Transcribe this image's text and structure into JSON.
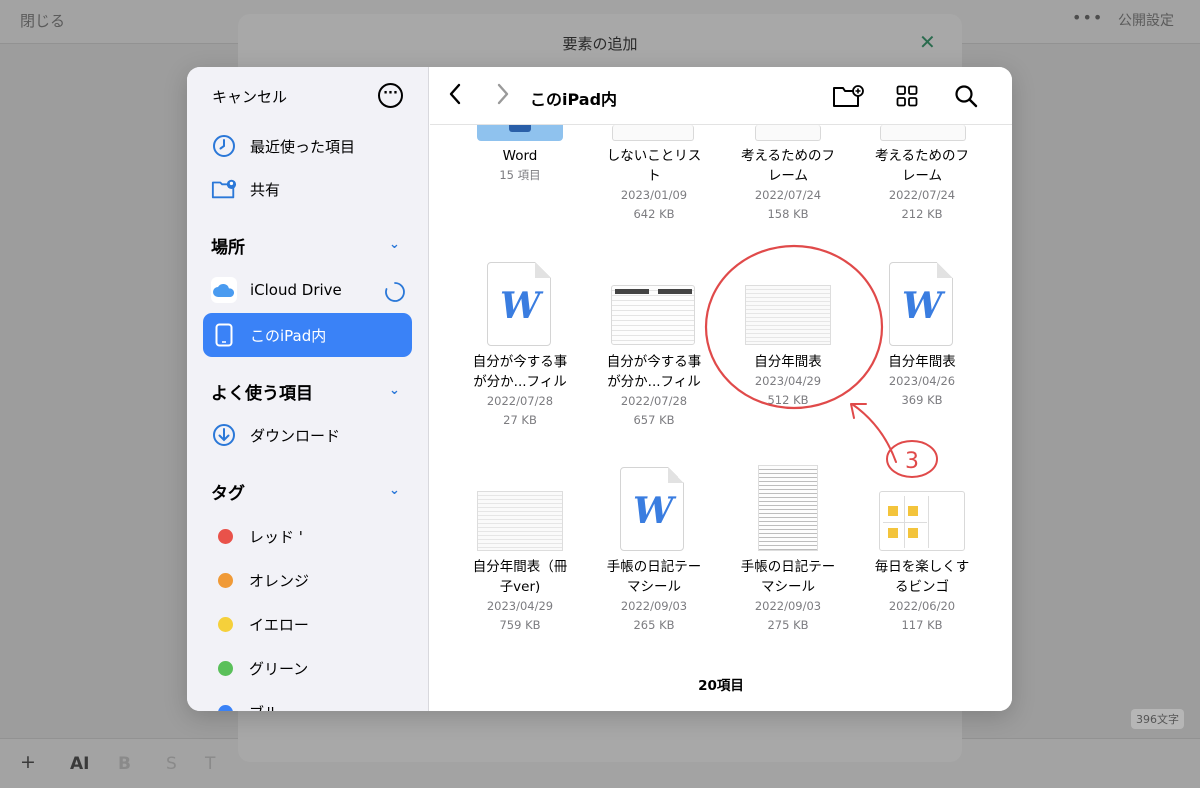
{
  "background": {
    "close_label": "閉じる",
    "more_label": "•••",
    "public_label": "公開設定",
    "word_count": "396文字",
    "toolbar": {
      "plus": "+",
      "ai": "AI",
      "bold": "B",
      "strike": "S",
      "text": "T"
    }
  },
  "sheet": {
    "title": "要素の追加"
  },
  "sidebar": {
    "cancel_label": "キャンセル",
    "recent_label": "最近使った項目",
    "shared_label": "共有",
    "locations_header": "場所",
    "icloud_label": "iCloud Drive",
    "ipad_label": "このiPad内",
    "favorites_header": "よく使う項目",
    "downloads_label": "ダウンロード",
    "tags_header": "タグ",
    "tags": [
      {
        "label": "レッド '",
        "color": "#e9524a"
      },
      {
        "label": "オレンジ",
        "color": "#f09a37"
      },
      {
        "label": "イエロー",
        "color": "#f5d03b"
      },
      {
        "label": "グリーン",
        "color": "#5ac05a"
      },
      {
        "label": "ブル",
        "color": "#3a82f7"
      }
    ]
  },
  "main": {
    "location_title": "このiPad内",
    "item_count": "20項目",
    "files": [
      {
        "name1": "Word",
        "name2": "",
        "date": "15 項目",
        "size": ""
      },
      {
        "name1": "しないことリス",
        "name2": "ト",
        "date": "2023/01/09",
        "size": "642 KB"
      },
      {
        "name1": "考えるためのフ",
        "name2": "レーム",
        "date": "2022/07/24",
        "size": "158 KB"
      },
      {
        "name1": "考えるためのフ",
        "name2": "レーム",
        "date": "2022/07/24",
        "size": "212 KB"
      },
      {
        "name1": "自分が今する事",
        "name2": "が分か...フィル",
        "date": "2022/07/28",
        "size": "27 KB"
      },
      {
        "name1": "自分が今する事",
        "name2": "が分か...フィル",
        "date": "2022/07/28",
        "size": "657 KB"
      },
      {
        "name1": "自分年間表",
        "name2": "",
        "date": "2023/04/29",
        "size": "512 KB"
      },
      {
        "name1": "自分年間表",
        "name2": "",
        "date": "2023/04/26",
        "size": "369 KB"
      },
      {
        "name1": "自分年間表（冊",
        "name2": "子ver)",
        "date": "2023/04/29",
        "size": "759 KB"
      },
      {
        "name1": "手帳の日記テー",
        "name2": "マシール",
        "date": "2022/09/03",
        "size": "265 KB"
      },
      {
        "name1": "手帳の日記テー",
        "name2": "マシール",
        "date": "2022/09/03",
        "size": "275 KB"
      },
      {
        "name1": "毎日を楽しくす",
        "name2": "るビンゴ",
        "date": "2022/06/20",
        "size": "117 KB"
      }
    ]
  },
  "annotation": {
    "number": "3",
    "color": "#e04a4a"
  },
  "colors": {
    "accent": "#3a82f7",
    "annotation": "#e04a4a"
  }
}
